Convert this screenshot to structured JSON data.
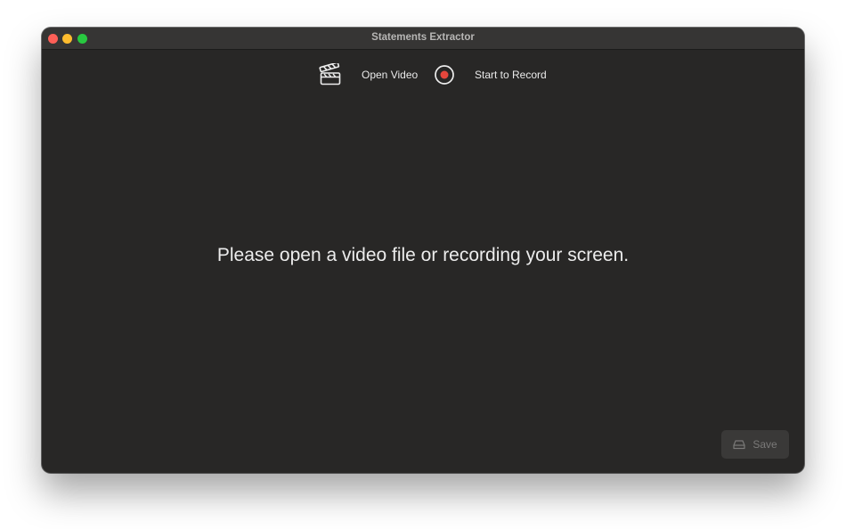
{
  "window": {
    "title": "Statements Extractor"
  },
  "toolbar": {
    "open_video_label": "Open Video",
    "record_label": "Start to Record"
  },
  "main": {
    "message": "Please open a video file or recording your screen."
  },
  "footer": {
    "save_label": "Save"
  },
  "colors": {
    "window_bg": "#282726",
    "titlebar_bg": "#363534",
    "record_dot": "#e5463c",
    "close": "#fe5f57",
    "minimize": "#febc2e",
    "maximize": "#28c840"
  }
}
